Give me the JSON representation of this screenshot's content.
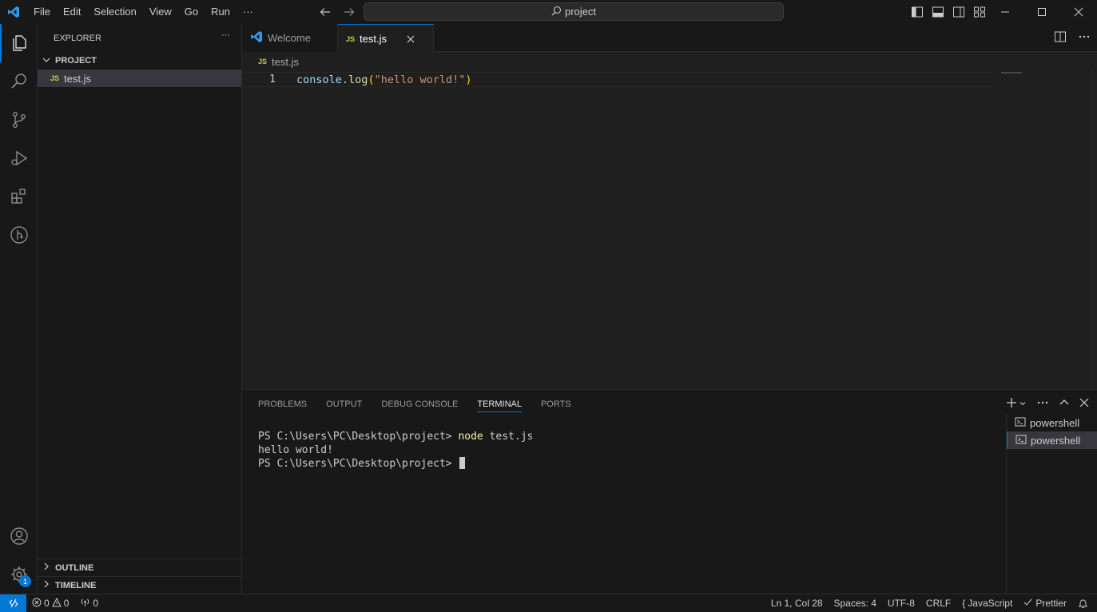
{
  "titlebar": {
    "menu": [
      "File",
      "Edit",
      "Selection",
      "View",
      "Go",
      "Run",
      "···"
    ],
    "search": "project"
  },
  "explorer": {
    "title": "EXPLORER",
    "more": "···",
    "project": "PROJECT",
    "file": "test.js",
    "js_badge": "JS",
    "outline": "OUTLINE",
    "timeline": "TIMELINE"
  },
  "tabs": [
    {
      "label": "Welcome"
    },
    {
      "label": "test.js",
      "badge": "JS"
    }
  ],
  "breadcrumb": {
    "badge": "JS",
    "file": "test.js"
  },
  "editor": {
    "line_number": "1",
    "tokens": {
      "obj": "console",
      "dot": ".",
      "fn": "log",
      "open": "(",
      "str": "\"hello world!\"",
      "close": ")"
    }
  },
  "panel": {
    "tabs": [
      "PROBLEMS",
      "OUTPUT",
      "DEBUG CONSOLE",
      "TERMINAL",
      "PORTS"
    ],
    "active_tab": "TERMINAL",
    "terminal": {
      "prompt1": "PS C:\\Users\\PC\\Desktop\\project> ",
      "cmd_node": "node",
      "cmd_arg": " test.js",
      "output": "hello world!",
      "prompt2": "PS C:\\Users\\PC\\Desktop\\project> "
    },
    "terminals": [
      "powershell",
      "powershell"
    ]
  },
  "activity": {
    "badge": "1"
  },
  "statusbar": {
    "errors": "0",
    "warnings": "0",
    "ports": "0",
    "position": "Ln 1, Col 28",
    "spaces": "Spaces: 4",
    "encoding": "UTF-8",
    "eol": "CRLF",
    "language": "JavaScript",
    "formatter": "Prettier"
  },
  "colors": {
    "accent": "#0078d4",
    "background": "#1f1f1f",
    "sidebar": "#181818"
  }
}
